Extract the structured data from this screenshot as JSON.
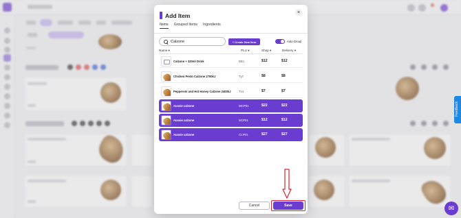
{
  "modal": {
    "title": "Add Item",
    "close_glyph": "×",
    "tabs": [
      {
        "label": "Items",
        "active": true
      },
      {
        "label": "Grouped Items",
        "active": false
      },
      {
        "label": "Ingredients",
        "active": false
      }
    ],
    "search": {
      "value": "Calzone",
      "placeholder": "Search"
    },
    "create_button": "+ Create New Item",
    "auto_group": {
      "label": "Auto Group",
      "on": true
    },
    "columns": {
      "name": "Name",
      "plu": "PLU",
      "shop": "Shop",
      "delivery": "Delivery"
    },
    "rows": [
      {
        "name": "Calzone + 330ml Drink",
        "plu": "BB1",
        "shop": "$12",
        "delivery": "$12",
        "selected": false,
        "thumb": "box"
      },
      {
        "name": "Chicken Pesto Calzone 2700kJ",
        "plu": "Ty7",
        "shop": "$8",
        "delivery": "$8",
        "selected": false,
        "thumb": "food"
      },
      {
        "name": "Pepperoni and Hot Honey Calzone 2400kJ",
        "plu": "Tx4",
        "shop": "$7",
        "delivery": "$7",
        "selected": false,
        "thumb": "food"
      },
      {
        "name": "Aussie calzone",
        "plu": "MCP01",
        "shop": "$22",
        "delivery": "$22",
        "selected": true,
        "thumb": "food"
      },
      {
        "name": "Aussie calzone",
        "plu": "SCP01",
        "shop": "$12",
        "delivery": "$12",
        "selected": true,
        "thumb": "food"
      },
      {
        "name": "Aussie calzone",
        "plu": "CLP01",
        "shop": "$27",
        "delivery": "$27",
        "selected": true,
        "thumb": "food"
      }
    ],
    "cancel_label": "Cancel",
    "save_label": "Save"
  },
  "background": {
    "feedback_label": "Feedback"
  },
  "colors": {
    "accent": "#6a3ccf",
    "highlight": "#e0202a",
    "feedback": "#1e88e5"
  },
  "icons": [
    "search-icon",
    "close-icon",
    "toggle-switch",
    "chat-icon",
    "arrow-down-annotation"
  ]
}
